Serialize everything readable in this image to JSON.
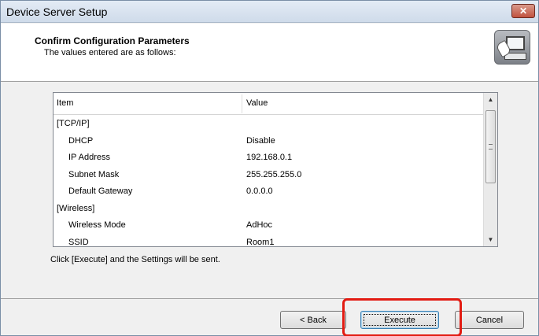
{
  "window": {
    "title": "Device Server Setup",
    "close_label": "✕"
  },
  "header": {
    "title": "Confirm Configuration Parameters",
    "subtitle": "The values entered are as follows:",
    "icon": "computer-wrench-icon"
  },
  "table": {
    "columns": [
      "Item",
      "Value"
    ],
    "rows": [
      {
        "item": "[TCP/IP]",
        "value": "",
        "indent": false
      },
      {
        "item": "DHCP",
        "value": "Disable",
        "indent": true
      },
      {
        "item": "IP Address",
        "value": "192.168.0.1",
        "indent": true
      },
      {
        "item": "Subnet Mask",
        "value": "255.255.255.0",
        "indent": true
      },
      {
        "item": "Default Gateway",
        "value": "0.0.0.0",
        "indent": true
      },
      {
        "item": "[Wireless]",
        "value": "",
        "indent": false
      },
      {
        "item": "Wireless Mode",
        "value": "AdHoc",
        "indent": true
      },
      {
        "item": "SSID",
        "value": "Room1",
        "indent": true
      }
    ],
    "scroll_up": "▲",
    "scroll_down": "▼"
  },
  "note": "Click [Execute] and the Settings will be sent.",
  "buttons": {
    "back": "< Back",
    "execute": "Execute",
    "cancel": "Cancel"
  },
  "colors": {
    "highlight": "#e21b12"
  }
}
